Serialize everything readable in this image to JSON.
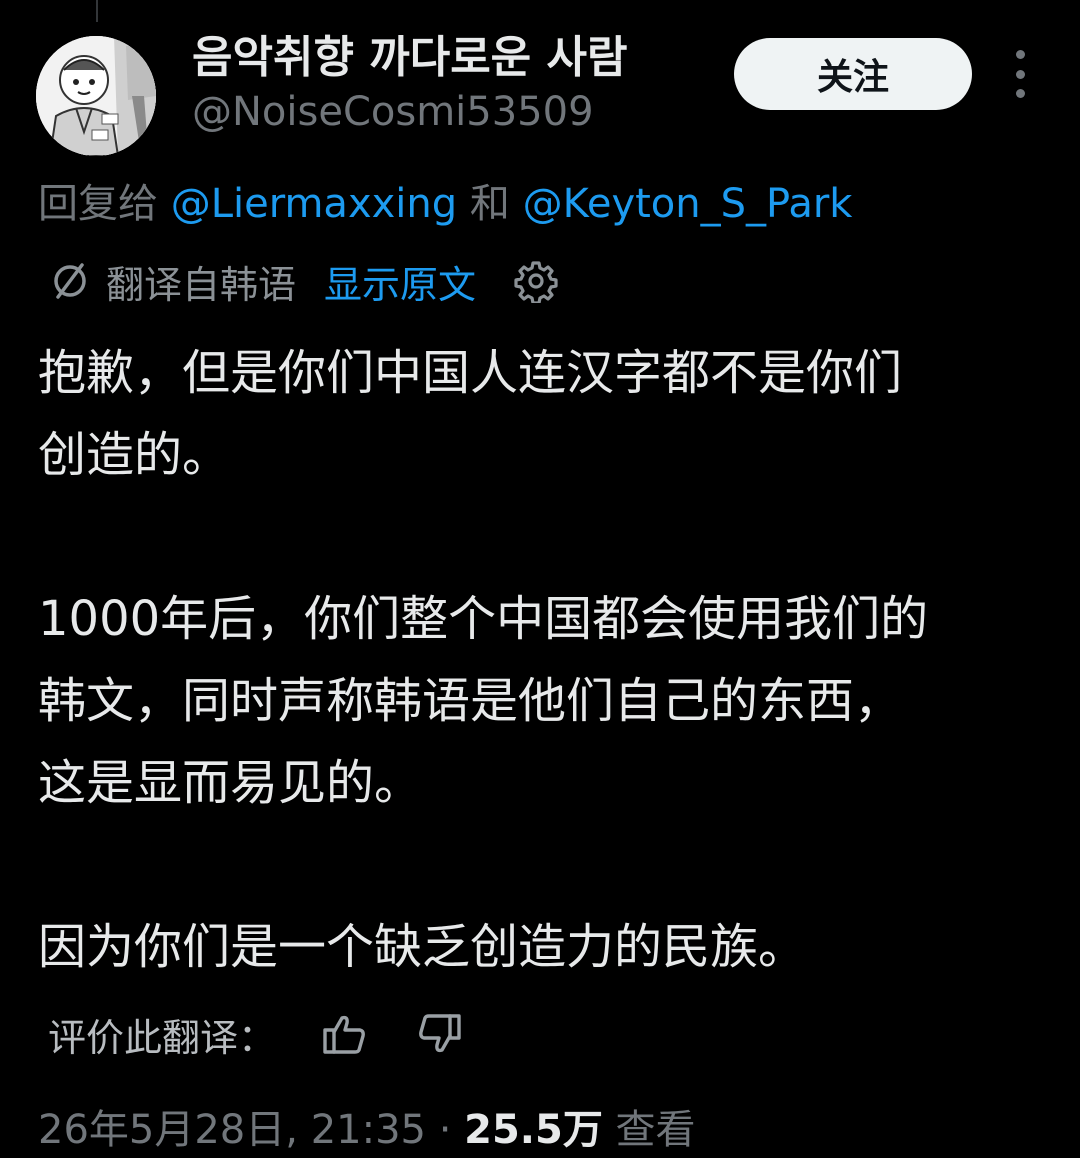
{
  "author": {
    "display_name": "음악취향 까다로운 사람",
    "handle": "@NoiseCosmi53509",
    "avatar_icon": "manga-character-avatar"
  },
  "actions": {
    "follow_label": "关注",
    "more_icon": "more-vertical-icon"
  },
  "reply": {
    "prefix": "回复给",
    "mention_1": "@Liermaxxing",
    "conjunction": "和",
    "mention_2": "@Keyton_S_Park"
  },
  "translation": {
    "icon": "translate-icon",
    "label": "翻译自韩语",
    "show_original": "显示原文",
    "settings_icon": "gear-icon"
  },
  "tweet": {
    "paragraph_1_line_1": "抱歉，但是你们中国人连汉字都不是你们",
    "paragraph_1_line_2": "创造的。",
    "paragraph_2_line_1": "1000年后，你们整个中国都会使用我们的",
    "paragraph_2_line_2": "韩文，同时声称韩语是他们自己的东西，",
    "paragraph_2_line_3": "这是显而易见的。",
    "paragraph_3": "因为你们是一个缺乏创造力的民族。"
  },
  "rate_translation": {
    "label": "评价此翻译：",
    "thumbs_up_icon": "thumbs-up-icon",
    "thumbs_down_icon": "thumbs-down-icon"
  },
  "meta": {
    "date": "26年5月28日",
    "time": "21:35",
    "separator": "·",
    "views_count": "25.5万",
    "views_label": "查看"
  },
  "colors": {
    "background": "#000000",
    "primary_text": "#e7e9ea",
    "secondary_text": "#71767b",
    "link": "#1d9bf0",
    "follow_button_bg": "#eff3f4"
  }
}
